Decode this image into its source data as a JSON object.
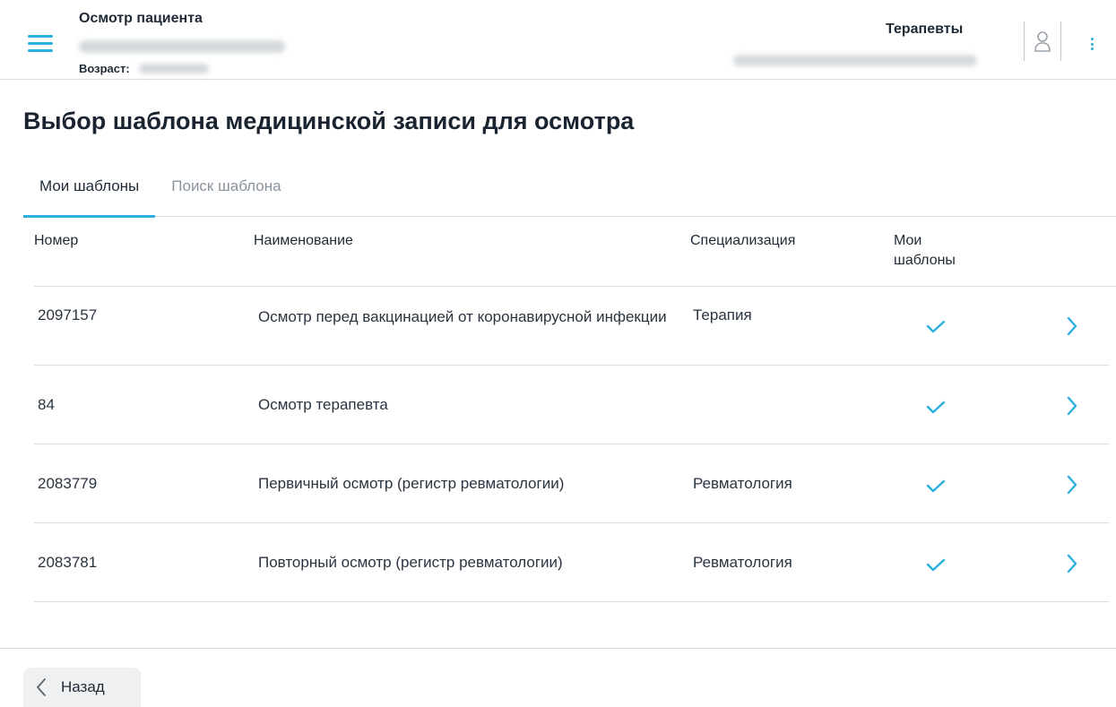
{
  "header": {
    "title": "Осмотр пациента",
    "age_label": "Возраст:",
    "department": "Терапевты"
  },
  "page": {
    "title": "Выбор шаблона медицинской записи для осмотра"
  },
  "tabs": [
    {
      "label": "Мои шаблоны",
      "active": true
    },
    {
      "label": "Поиск шаблона",
      "active": false
    }
  ],
  "table": {
    "columns": {
      "number": "Номер",
      "name": "Наименование",
      "specialization": "Специализация",
      "mine_line1": "Мои",
      "mine_line2": "шаблоны"
    },
    "rows": [
      {
        "number": "2097157",
        "name": "Осмотр перед вакцинацией от коронавирусной инфекции",
        "specialization": "Терапия",
        "mine": true
      },
      {
        "number": "84",
        "name": "Осмотр терапевта",
        "specialization": "",
        "mine": true
      },
      {
        "number": "2083779",
        "name": "Первичный осмотр (регистр ревматологии)",
        "specialization": "Ревматология",
        "mine": true
      },
      {
        "number": "2083781",
        "name": "Повторный осмотр (регистр ревматологии)",
        "specialization": "Ревматология",
        "mine": true
      }
    ]
  },
  "footer": {
    "back_label": "Назад"
  },
  "icons": {
    "menu": "hamburger-icon",
    "avatar": "user-icon",
    "more": "kebab-menu-icon",
    "check": "check-icon",
    "row_open": "chevron-right-icon",
    "back": "chevron-left-icon"
  },
  "colors": {
    "accent": "#2ab0dc",
    "text": "#1f2a36",
    "muted": "#8a949e",
    "divider": "#d9dde2"
  }
}
